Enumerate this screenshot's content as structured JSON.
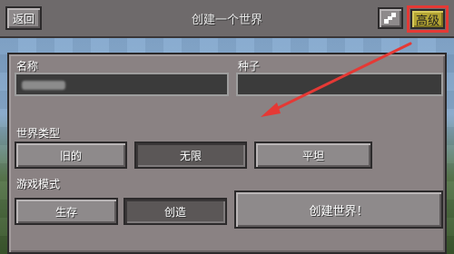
{
  "header": {
    "back_label": "返回",
    "title": "创建一个世界",
    "advanced_label": "高级",
    "icon": "seed-dice-icon"
  },
  "form": {
    "name_label": "名称",
    "seed_label": "种子",
    "name_value": "",
    "seed_value": ""
  },
  "world_type": {
    "label": "世界类型",
    "options": [
      "旧的",
      "无限",
      "平坦"
    ],
    "selected": "无限"
  },
  "game_mode": {
    "label": "游戏模式",
    "options": [
      "生存",
      "创造"
    ],
    "selected": "创造"
  },
  "create_label": "创建世界！",
  "colors": {
    "highlight": "#e53935",
    "advanced_bg": "#b4a534"
  }
}
